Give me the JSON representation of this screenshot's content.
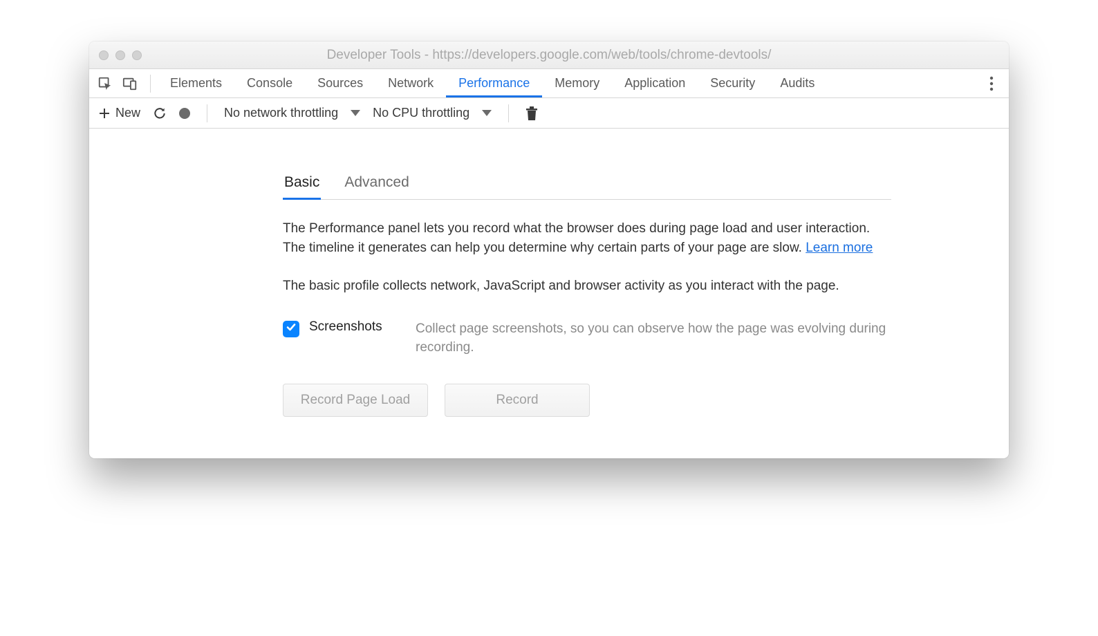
{
  "window": {
    "title": "Developer Tools - https://developers.google.com/web/tools/chrome-devtools/"
  },
  "tabs": {
    "items": [
      "Elements",
      "Console",
      "Sources",
      "Network",
      "Performance",
      "Memory",
      "Application",
      "Security",
      "Audits"
    ],
    "active_index": 4
  },
  "toolbar": {
    "new_label": "New",
    "network_throttle": "No network throttling",
    "cpu_throttle": "No CPU throttling"
  },
  "panel": {
    "subtabs": {
      "items": [
        "Basic",
        "Advanced"
      ],
      "active_index": 0
    },
    "intro_text": "The Performance panel lets you record what the browser does during page load and user interaction. The timeline it generates can help you determine why certain parts of your page are slow.  ",
    "learn_more": "Learn more",
    "basic_text": "The basic profile collects network, JavaScript and browser activity as you interact with the page.",
    "option": {
      "label": "Screenshots",
      "description": "Collect page screenshots, so you can observe how the page was evolving during recording.",
      "checked": true
    },
    "buttons": {
      "record_page_load": "Record Page Load",
      "record": "Record"
    }
  }
}
